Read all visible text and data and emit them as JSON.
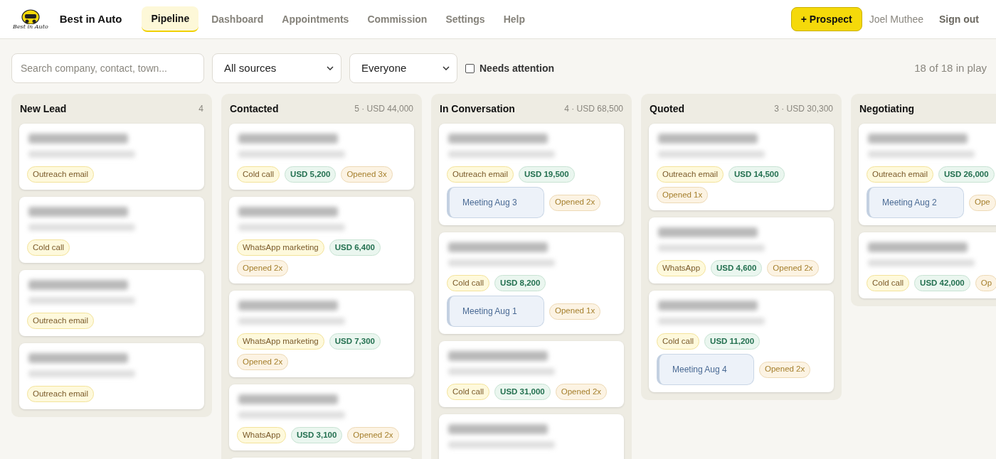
{
  "brand": {
    "name": "Best in Auto",
    "logo_caption": "Best in Auto"
  },
  "nav": [
    {
      "label": "Pipeline",
      "selected": true
    },
    {
      "label": "Dashboard",
      "selected": false
    },
    {
      "label": "Appointments",
      "selected": false
    },
    {
      "label": "Commission",
      "selected": false
    },
    {
      "label": "Settings",
      "selected": false
    },
    {
      "label": "Help",
      "selected": false
    }
  ],
  "actions": {
    "new_button": "+ Prospect",
    "user": "Joel Muthee",
    "sign_out": "Sign out"
  },
  "filters": {
    "search": {
      "placeholder": "Search company, contact, town..."
    },
    "source": "All sources",
    "owner": "Everyone",
    "needs_attention": {
      "label": "Needs attention",
      "checked": false
    },
    "summary": "18 of 18 in play"
  },
  "columns": [
    {
      "title": "New Lead",
      "meta": "4",
      "cards": [
        {
          "tags": [
            {
              "kind": "source",
              "text": "Outreach email"
            }
          ]
        },
        {
          "tags": [
            {
              "kind": "source",
              "text": "Cold call"
            }
          ]
        },
        {
          "tags": [
            {
              "kind": "source",
              "text": "Outreach email"
            }
          ]
        },
        {
          "tags": [
            {
              "kind": "source",
              "text": "Outreach email"
            }
          ]
        }
      ]
    },
    {
      "title": "Contacted",
      "meta": "5 · USD 44,000",
      "more_below": true,
      "cards": [
        {
          "tags": [
            {
              "kind": "source",
              "text": "Cold call"
            },
            {
              "kind": "amount",
              "text": "USD 5,200"
            },
            {
              "kind": "opened",
              "text": "Opened 3x"
            }
          ]
        },
        {
          "tags": [
            {
              "kind": "source",
              "text": "WhatsApp marketing"
            },
            {
              "kind": "amount",
              "text": "USD 6,400"
            },
            {
              "kind": "opened",
              "text": "Opened 2x"
            }
          ]
        },
        {
          "tags": [
            {
              "kind": "source",
              "text": "WhatsApp marketing"
            },
            {
              "kind": "amount",
              "text": "USD 7,300"
            },
            {
              "kind": "opened",
              "text": "Opened 2x"
            }
          ]
        },
        {
          "tags": [
            {
              "kind": "source",
              "text": "WhatsApp"
            },
            {
              "kind": "amount",
              "text": "USD 3,100"
            },
            {
              "kind": "opened",
              "text": "Opened 2x"
            }
          ]
        }
      ]
    },
    {
      "title": "In Conversation",
      "meta": "4 · USD 68,500",
      "more_below": true,
      "cards": [
        {
          "tags": [
            {
              "kind": "source",
              "text": "Outreach email"
            },
            {
              "kind": "amount",
              "text": "USD 19,500"
            },
            {
              "kind": "meeting",
              "text": "Meeting Aug 3"
            },
            {
              "kind": "opened",
              "text": "Opened 2x"
            }
          ]
        },
        {
          "tags": [
            {
              "kind": "source",
              "text": "Cold call"
            },
            {
              "kind": "amount",
              "text": "USD 8,200"
            },
            {
              "kind": "meeting",
              "text": "Meeting Aug 1"
            },
            {
              "kind": "opened",
              "text": "Opened 1x"
            }
          ]
        },
        {
          "tags": [
            {
              "kind": "source",
              "text": "Cold call"
            },
            {
              "kind": "amount",
              "text": "USD 31,000"
            },
            {
              "kind": "opened",
              "text": "Opened 2x"
            }
          ]
        }
      ]
    },
    {
      "title": "Quoted",
      "meta": "3 · USD 30,300",
      "cards": [
        {
          "tags": [
            {
              "kind": "source",
              "text": "Outreach email"
            },
            {
              "kind": "amount",
              "text": "USD 14,500"
            },
            {
              "kind": "opened",
              "text": "Opened 1x"
            }
          ]
        },
        {
          "tags": [
            {
              "kind": "source",
              "text": "WhatsApp"
            },
            {
              "kind": "amount",
              "text": "USD 4,600"
            },
            {
              "kind": "opened",
              "text": "Opened 2x"
            }
          ]
        },
        {
          "tags": [
            {
              "kind": "source",
              "text": "Cold call"
            },
            {
              "kind": "amount",
              "text": "USD 11,200"
            },
            {
              "kind": "meeting",
              "text": "Meeting Aug 4"
            },
            {
              "kind": "opened",
              "text": "Opened 2x"
            }
          ]
        }
      ]
    },
    {
      "title": "Negotiating",
      "cards": [
        {
          "tags": [
            {
              "kind": "source",
              "text": "Outreach email"
            },
            {
              "kind": "amount",
              "text": "USD 26,000"
            },
            {
              "kind": "meeting",
              "text": "Meeting Aug 2"
            },
            {
              "kind": "opened",
              "text": "Ope"
            }
          ]
        },
        {
          "tags": [
            {
              "kind": "source",
              "text": "Cold call"
            },
            {
              "kind": "amount",
              "text": "USD 42,000"
            },
            {
              "kind": "opened",
              "text": "Op"
            }
          ]
        }
      ]
    }
  ]
}
